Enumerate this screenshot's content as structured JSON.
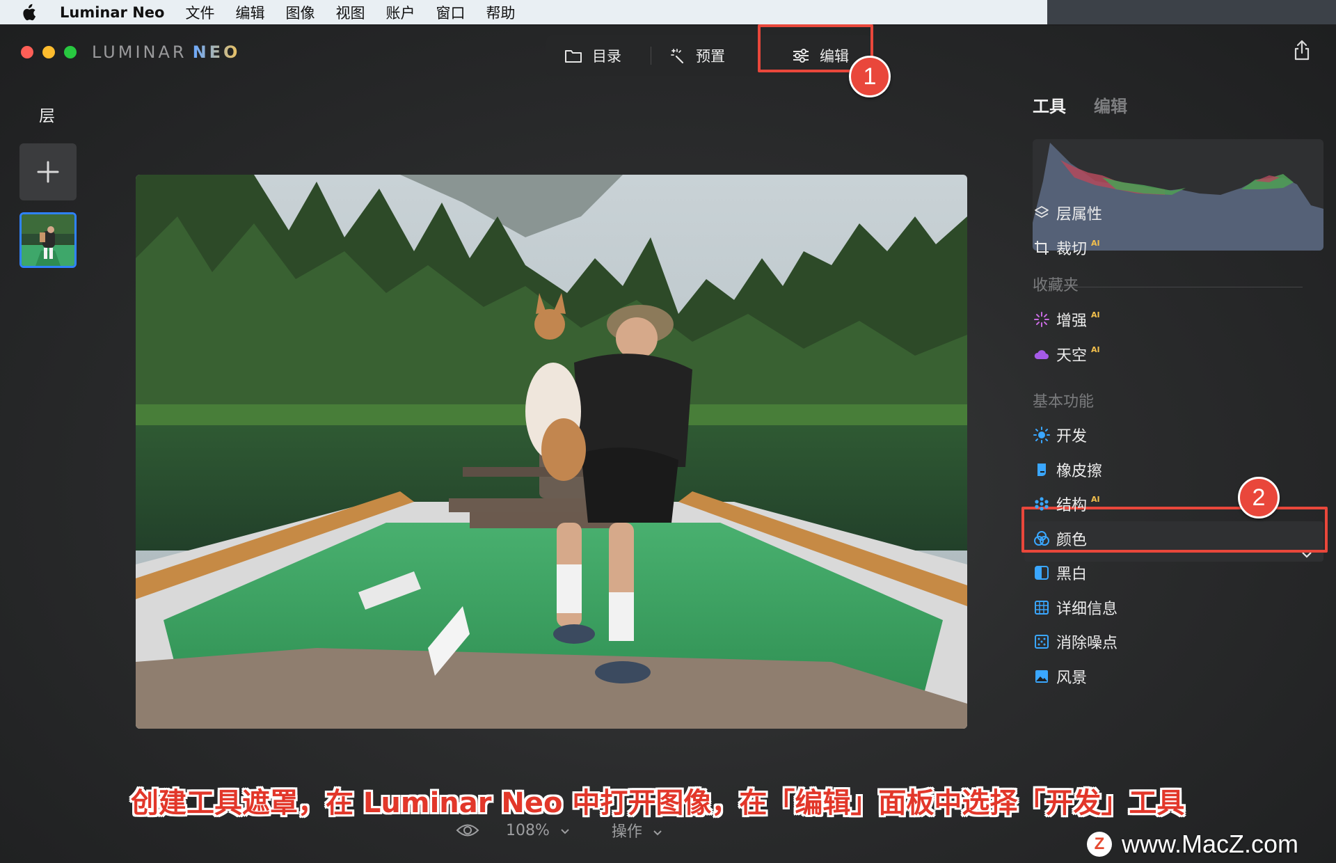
{
  "menubar": {
    "app_name": "Luminar Neo",
    "items": [
      "文件",
      "编辑",
      "图像",
      "视图",
      "账户",
      "窗口",
      "帮助"
    ]
  },
  "window": {
    "brand_part1": "LUMINAR",
    "brand_part2": "NEO"
  },
  "top_tabs": {
    "catalog": "目录",
    "presets": "预置",
    "edit": "编辑",
    "active": "edit"
  },
  "left_panel": {
    "title": "层"
  },
  "bottom": {
    "zoom": "108%",
    "actions": "操作"
  },
  "right_panel": {
    "tabs": [
      "工具",
      "编辑"
    ],
    "tools_top": [
      {
        "label": "层属性",
        "icon": "layers-icon"
      },
      {
        "label": "裁切",
        "icon": "crop-icon",
        "ai": "AI"
      }
    ],
    "favorites_title": "收藏夹",
    "favorites": [
      {
        "label": "增强",
        "icon": "enhance-icon",
        "ai": "AI"
      },
      {
        "label": "天空",
        "icon": "sky-icon",
        "ai": "AI"
      }
    ],
    "essentials_title": "基本功能",
    "essentials": [
      {
        "label": "开发",
        "icon": "develop-icon"
      },
      {
        "label": "橡皮擦",
        "icon": "eraser-icon"
      },
      {
        "label": "结构",
        "icon": "structure-icon",
        "ai": "AI"
      },
      {
        "label": "颜色",
        "icon": "color-icon"
      },
      {
        "label": "黑白",
        "icon": "bw-icon"
      },
      {
        "label": "详细信息",
        "icon": "details-icon"
      },
      {
        "label": "消除噪点",
        "icon": "denoise-icon"
      },
      {
        "label": "风景",
        "icon": "landscape-icon"
      }
    ]
  },
  "annotations": {
    "step1": "1",
    "step2": "2",
    "caption": "创建工具遮罩，在 Luminar Neo 中打开图像，在「编辑」面板中选择「开发」工具",
    "watermark": "www.MacZ.com",
    "watermark_logo": "Z"
  },
  "colors": {
    "highlight": "#e9473b",
    "accent_blue": "#2f82ff",
    "ai_badge": "#f3c04c"
  }
}
